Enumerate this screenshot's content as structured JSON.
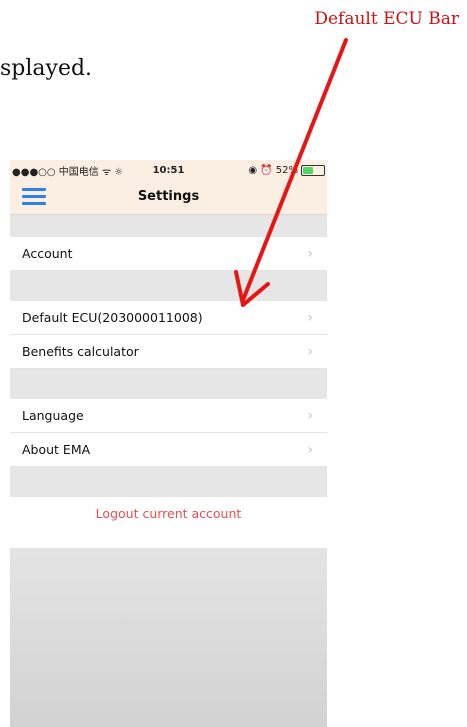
{
  "doc_fragment": "splayed.",
  "callout": {
    "label": "Default ECU Bar",
    "color": "#cc1111"
  },
  "status_bar": {
    "signal": "●●●○○ 中国电信 ᯤ ☼",
    "time": "10:51",
    "icons": "◉ ⏰",
    "battery": "52%",
    "battery_level": 0.52,
    "battery_color": "#4cd964"
  },
  "nav": {
    "title": "Settings",
    "menu_icon": "hamburger-menu-icon",
    "accent": "#2f80ed"
  },
  "settings": {
    "group1": [
      {
        "label": "Account"
      }
    ],
    "group2": [
      {
        "label": "Default ECU(203000011008)"
      },
      {
        "label": "Benefits calculator"
      }
    ],
    "group3": [
      {
        "label": "Language"
      },
      {
        "label": "About EMA"
      }
    ],
    "chevron": "›"
  },
  "logout": {
    "label": "Logout current account",
    "color": "#e05050"
  }
}
